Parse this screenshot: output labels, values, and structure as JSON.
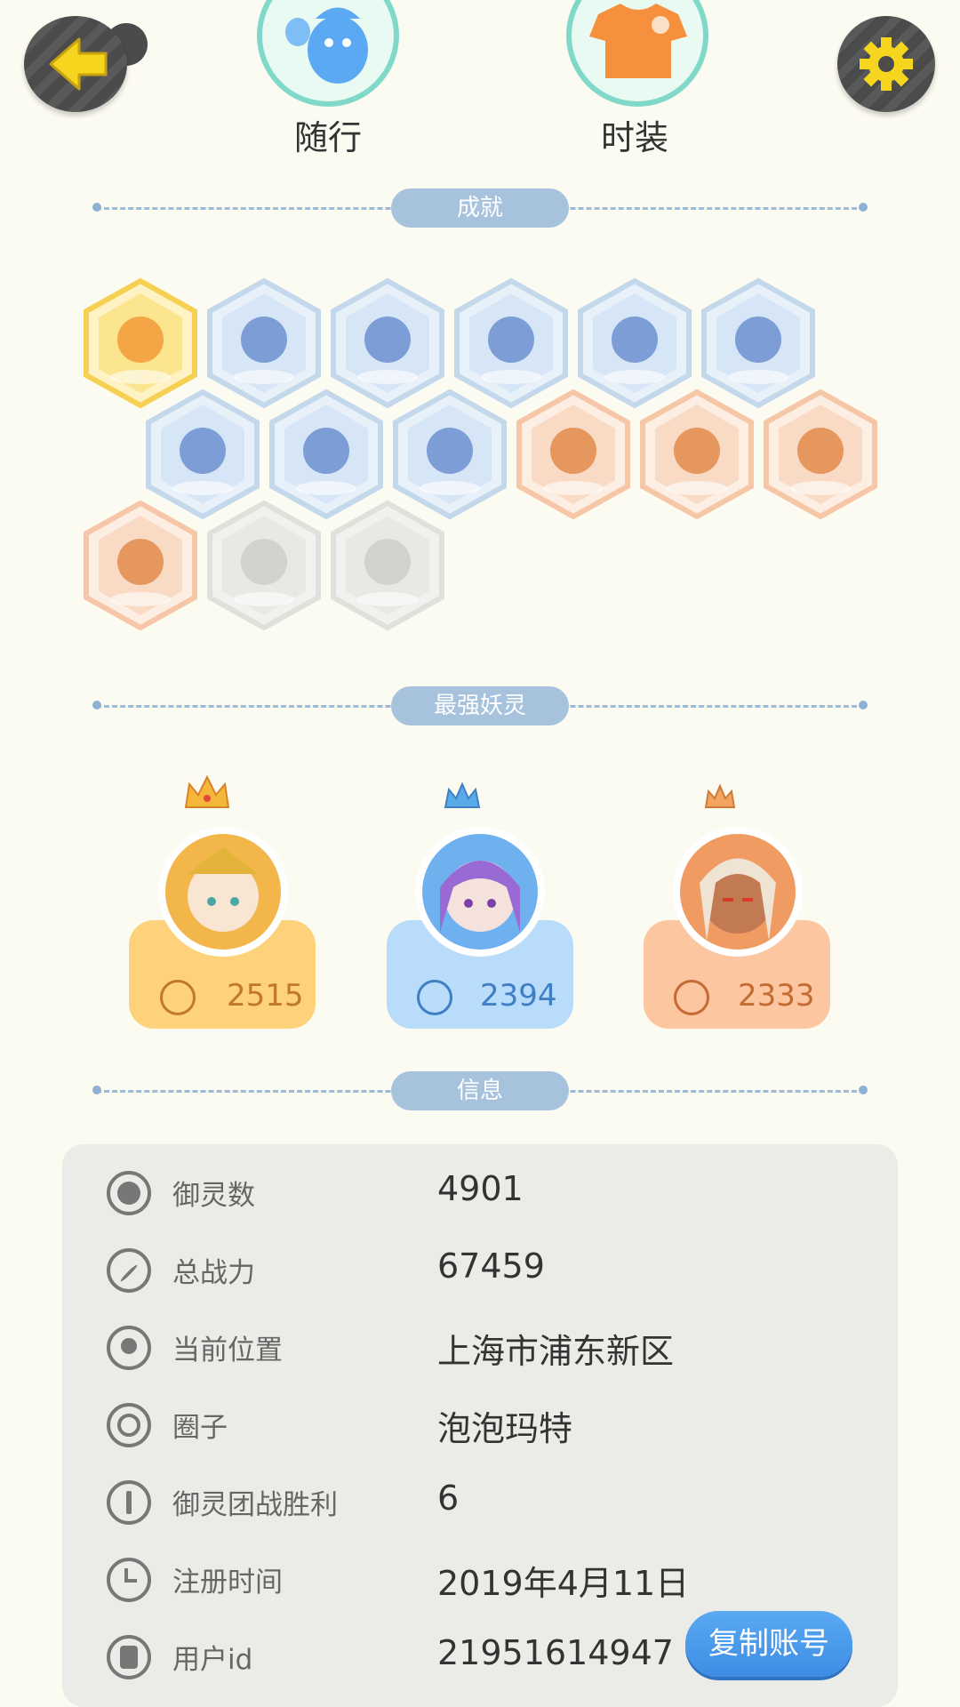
{
  "header": {
    "companion_label": "随行",
    "fashion_label": "时装"
  },
  "sections": {
    "achievements": "成就",
    "strongest_spirits": "最强妖灵",
    "info": "信息"
  },
  "achievements": [
    {
      "name": "fox-badge",
      "tier": "gold"
    },
    {
      "name": "shoe-badge",
      "tier": "blue"
    },
    {
      "name": "target-badge",
      "tier": "blue"
    },
    {
      "name": "orb-badge",
      "tier": "blue"
    },
    {
      "name": "yinyang-wave-badge",
      "tier": "blue"
    },
    {
      "name": "spirit-badge",
      "tier": "blue"
    },
    {
      "name": "cart-badge",
      "tier": "blue"
    },
    {
      "name": "cat-flower-badge",
      "tier": "blue"
    },
    {
      "name": "yinyang-card-badge",
      "tier": "blue"
    },
    {
      "name": "moon-badge",
      "tier": "orange"
    },
    {
      "name": "crystal-badge",
      "tier": "orange"
    },
    {
      "name": "scroll-badge",
      "tier": "orange"
    },
    {
      "name": "book-badge",
      "tier": "orange"
    },
    {
      "name": "fish-badge",
      "tier": "locked"
    },
    {
      "name": "demon-badge",
      "tier": "locked"
    }
  ],
  "spirits": [
    {
      "power": "2515",
      "color": "#fdd27a",
      "text_color": "#c0792a",
      "ring": "#f2b64a"
    },
    {
      "power": "2394",
      "color": "#b9dcfb",
      "text_color": "#3f7fc4",
      "ring": "#6fb1ee"
    },
    {
      "power": "2333",
      "color": "#fbc6a0",
      "text_color": "#c66a33",
      "ring": "#f09b62"
    }
  ],
  "info": {
    "rows": [
      {
        "label": "御灵数",
        "value": "4901",
        "icon": "spirit-count-icon"
      },
      {
        "label": "总战力",
        "value": "67459",
        "icon": "sword-icon"
      },
      {
        "label": "当前位置",
        "value": "上海市浦东新区",
        "icon": "location-pin-icon"
      },
      {
        "label": "圈子",
        "value": "泡泡玛特",
        "icon": "circle-icon"
      },
      {
        "label": "御灵团战胜利",
        "value": "6",
        "icon": "team-battle-icon"
      },
      {
        "label": "注册时间",
        "value": "2019年4月11日",
        "icon": "clock-icon"
      },
      {
        "label": "用户id",
        "value": "21951614947",
        "icon": "id-card-icon"
      }
    ],
    "copy_button": "复制账号"
  },
  "colors": {
    "background": "#fcfbf2",
    "accent_blue": "#4a97ea",
    "section_pill": "#a6c2dd"
  }
}
